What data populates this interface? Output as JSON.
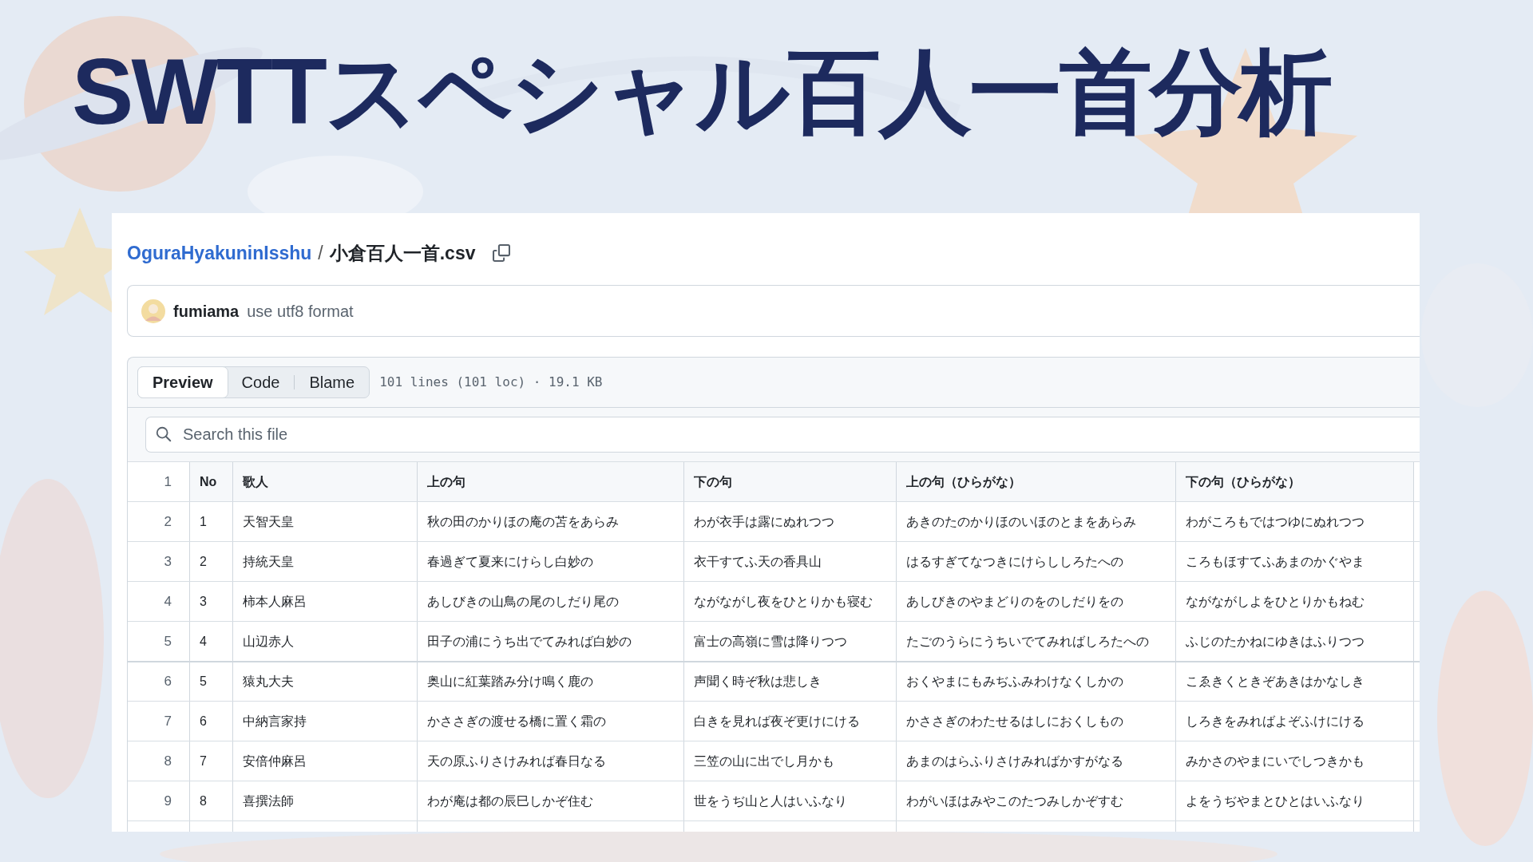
{
  "slide_title": "SWTTスペシャル百人一首分析",
  "breadcrumb": {
    "repo": "OguraHyakuninIsshu",
    "separator": "/",
    "file": "小倉百人一首.csv"
  },
  "commit": {
    "author": "fumiama",
    "message": "use utf8 format"
  },
  "tabs": [
    {
      "label": "Preview",
      "selected": true
    },
    {
      "label": "Code",
      "selected": false
    },
    {
      "label": "Blame",
      "selected": false
    }
  ],
  "file_info": "101 lines (101 loc) · 19.1 KB",
  "search": {
    "placeholder": "Search this file"
  },
  "table": {
    "header": {
      "line": "1",
      "cells": [
        "No",
        "歌人",
        "上の句",
        "下の句",
        "上の句（ひらがな）",
        "下の句（ひらがな）"
      ]
    },
    "rows": [
      {
        "line": "2",
        "cells": [
          "1",
          "天智天皇",
          "秋の田のかりほの庵の苫をあらみ",
          "わが衣手は露にぬれつつ",
          "あきのたのかりほのいほのとまをあらみ",
          "わがころもではつゆにぬれつつ"
        ]
      },
      {
        "line": "3",
        "cells": [
          "2",
          "持統天皇",
          "春過ぎて夏来にけらし白妙の",
          "衣干すてふ天の香具山",
          "はるすぎてなつきにけらししろたへの",
          "ころもほすてふあまのかぐやま"
        ]
      },
      {
        "line": "4",
        "cells": [
          "3",
          "柿本人麻呂",
          "あしびきの山鳥の尾のしだり尾の",
          "ながながし夜をひとりかも寝む",
          "あしびきのやまどりのをのしだりをの",
          "ながながしよをひとりかもねむ"
        ]
      },
      {
        "line": "5",
        "cells": [
          "4",
          "山辺赤人",
          "田子の浦にうち出でてみれば白妙の",
          "富士の高嶺に雪は降りつつ",
          "たごのうらにうちいでてみればしろたへの",
          "ふじのたかねにゆきはふりつつ"
        ]
      },
      {
        "line": "6",
        "cells": [
          "5",
          "猿丸大夫",
          "奥山に紅葉踏み分け鳴く鹿の",
          "声聞く時ぞ秋は悲しき",
          "おくやまにもみぢふみわけなくしかの",
          "こゑきくときぞあきはかなしき"
        ]
      },
      {
        "line": "7",
        "cells": [
          "6",
          "中納言家持",
          "かささぎの渡せる橋に置く霜の",
          "白きを見れば夜ぞ更けにける",
          "かささぎのわたせるはしにおくしもの",
          "しろきをみればよぞふけにける"
        ]
      },
      {
        "line": "8",
        "cells": [
          "7",
          "安倍仲麻呂",
          "天の原ふりさけみれば春日なる",
          "三笠の山に出でし月かも",
          "あまのはらふりさけみればかすがなる",
          "みかさのやまにいでしつきかも"
        ]
      },
      {
        "line": "9",
        "cells": [
          "8",
          "喜撰法師",
          "わが庵は都の辰巳しかぞ住む",
          "世をうぢ山と人はいふなり",
          "わがいほはみやこのたつみしかぞすむ",
          "よをうぢやまとひとはいふなり"
        ]
      }
    ]
  }
}
